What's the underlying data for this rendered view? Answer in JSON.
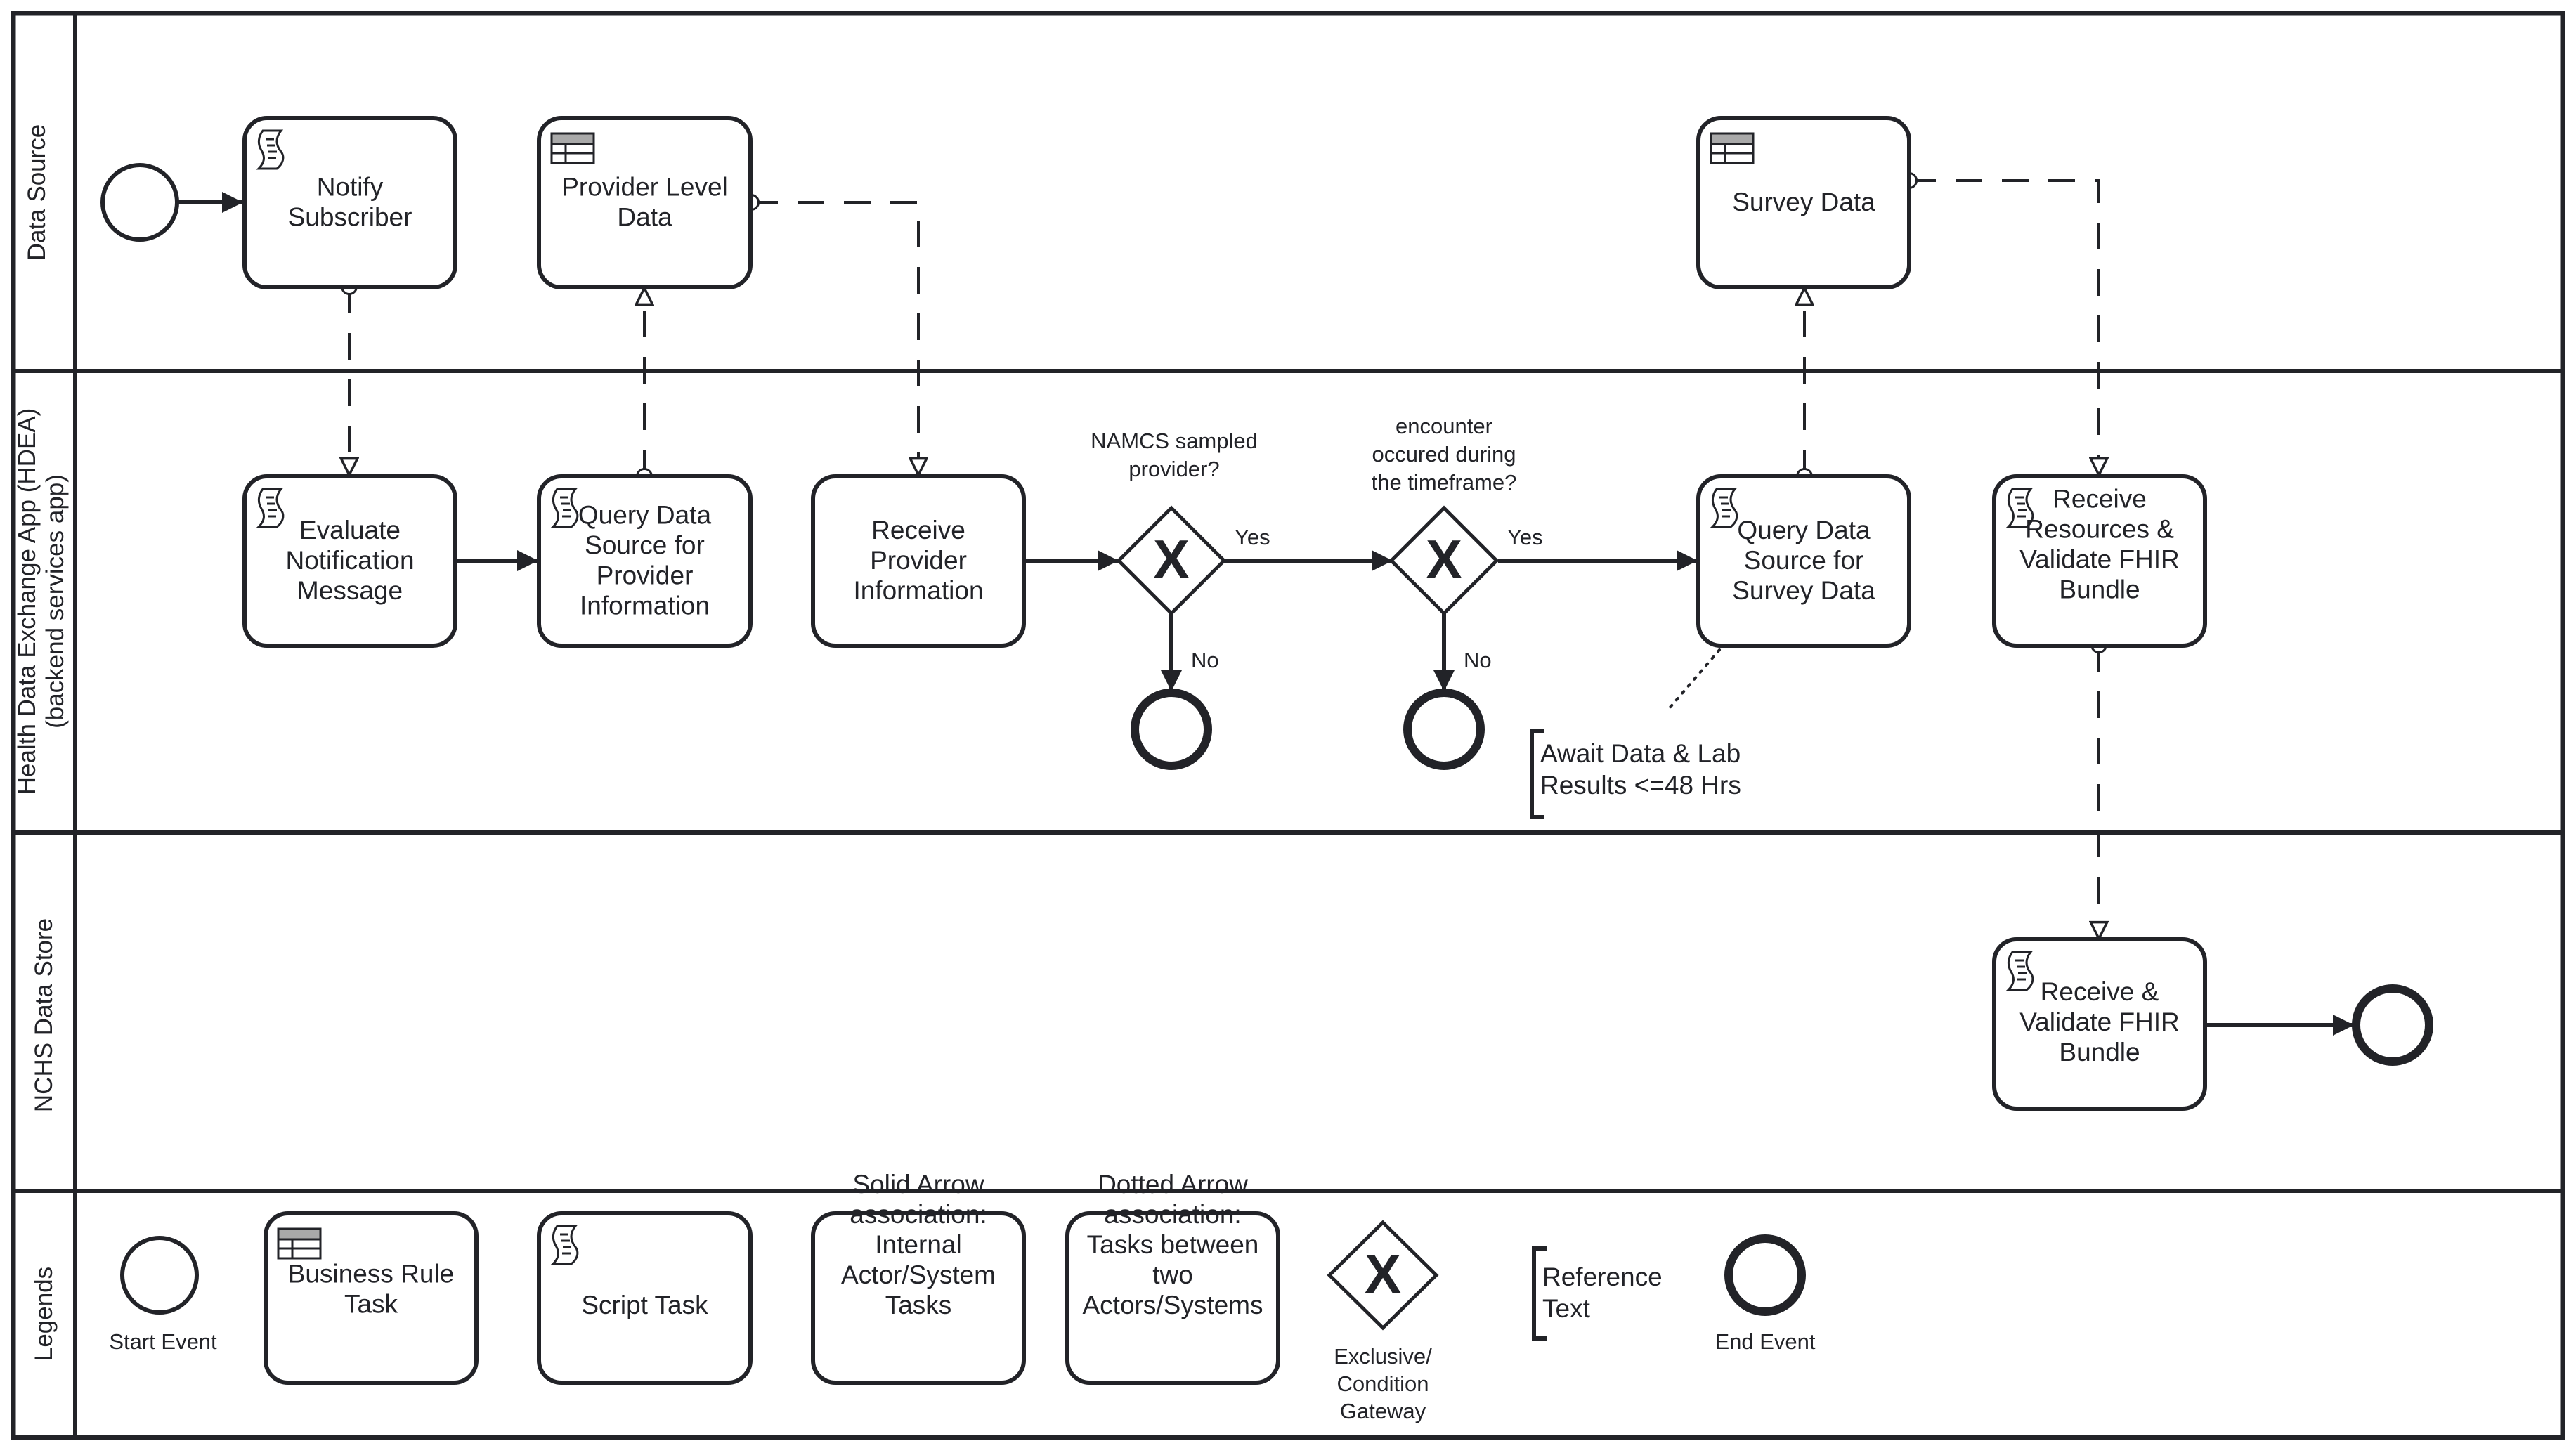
{
  "lanes": [
    {
      "id": "data-source",
      "label": [
        "Data Source"
      ]
    },
    {
      "id": "hdea",
      "label": [
        "Health Data Exchange App (HDEA)",
        "(backend services app)"
      ]
    },
    {
      "id": "nchs",
      "label": [
        "NCHS Data Store"
      ]
    },
    {
      "id": "legends",
      "label": [
        "Legends"
      ]
    }
  ],
  "tasks": {
    "notify_subscriber": {
      "type": "script",
      "lines": [
        "Notify",
        "Subscriber"
      ]
    },
    "provider_level_data": {
      "type": "business-rule",
      "lines": [
        "Provider Level",
        "Data"
      ]
    },
    "survey_data": {
      "type": "business-rule",
      "lines": [
        "Survey Data"
      ]
    },
    "evaluate_notification": {
      "type": "script",
      "lines": [
        "Evaluate",
        "Notification",
        "Message"
      ]
    },
    "query_provider": {
      "type": "script",
      "lines": [
        "Query Data",
        "Source for",
        "Provider",
        "Information"
      ]
    },
    "receive_provider": {
      "type": "task",
      "lines": [
        "Receive",
        "Provider",
        "Information"
      ]
    },
    "query_survey": {
      "type": "script",
      "lines": [
        "Query Data",
        "Source for",
        "Survey Data"
      ]
    },
    "receive_resources": {
      "type": "script",
      "lines": [
        "Receive",
        "Resources &",
        "Validate FHIR",
        "Bundle"
      ]
    },
    "receive_validate": {
      "type": "script",
      "lines": [
        "Receive &",
        "Validate FHIR",
        "Bundle"
      ]
    }
  },
  "gateways": {
    "namcs": {
      "question": [
        "NAMCS sampled",
        "provider?"
      ],
      "yes": "Yes",
      "no": "No",
      "marker": "X"
    },
    "encounter": {
      "question": [
        "encounter",
        "occured during",
        "the timeframe?"
      ],
      "yes": "Yes",
      "no": "No",
      "marker": "X"
    }
  },
  "annotation": {
    "lines": [
      "Await Data & Lab",
      "Results <=48 Hrs"
    ]
  },
  "legend": {
    "start_event": "Start Event",
    "business_rule": [
      "Business Rule",
      "Task"
    ],
    "script_task": [
      "Script Task"
    ],
    "solid_arrow": [
      "Solid Arrow",
      "association:",
      "Internal",
      "Actor/System",
      "Tasks"
    ],
    "dotted_arrow": [
      "Dotted Arrow",
      "association:",
      "Tasks between",
      "two",
      "Actors/Systems"
    ],
    "gateway": [
      "Exclusive/",
      "Condition",
      "Gateway"
    ],
    "gateway_marker": "X",
    "reference_text": [
      "Reference",
      "Text"
    ],
    "end_event": "End Event"
  },
  "colors": {
    "stroke": "#222328",
    "background": "#ffffff",
    "table_header": "#a9a9a9"
  }
}
